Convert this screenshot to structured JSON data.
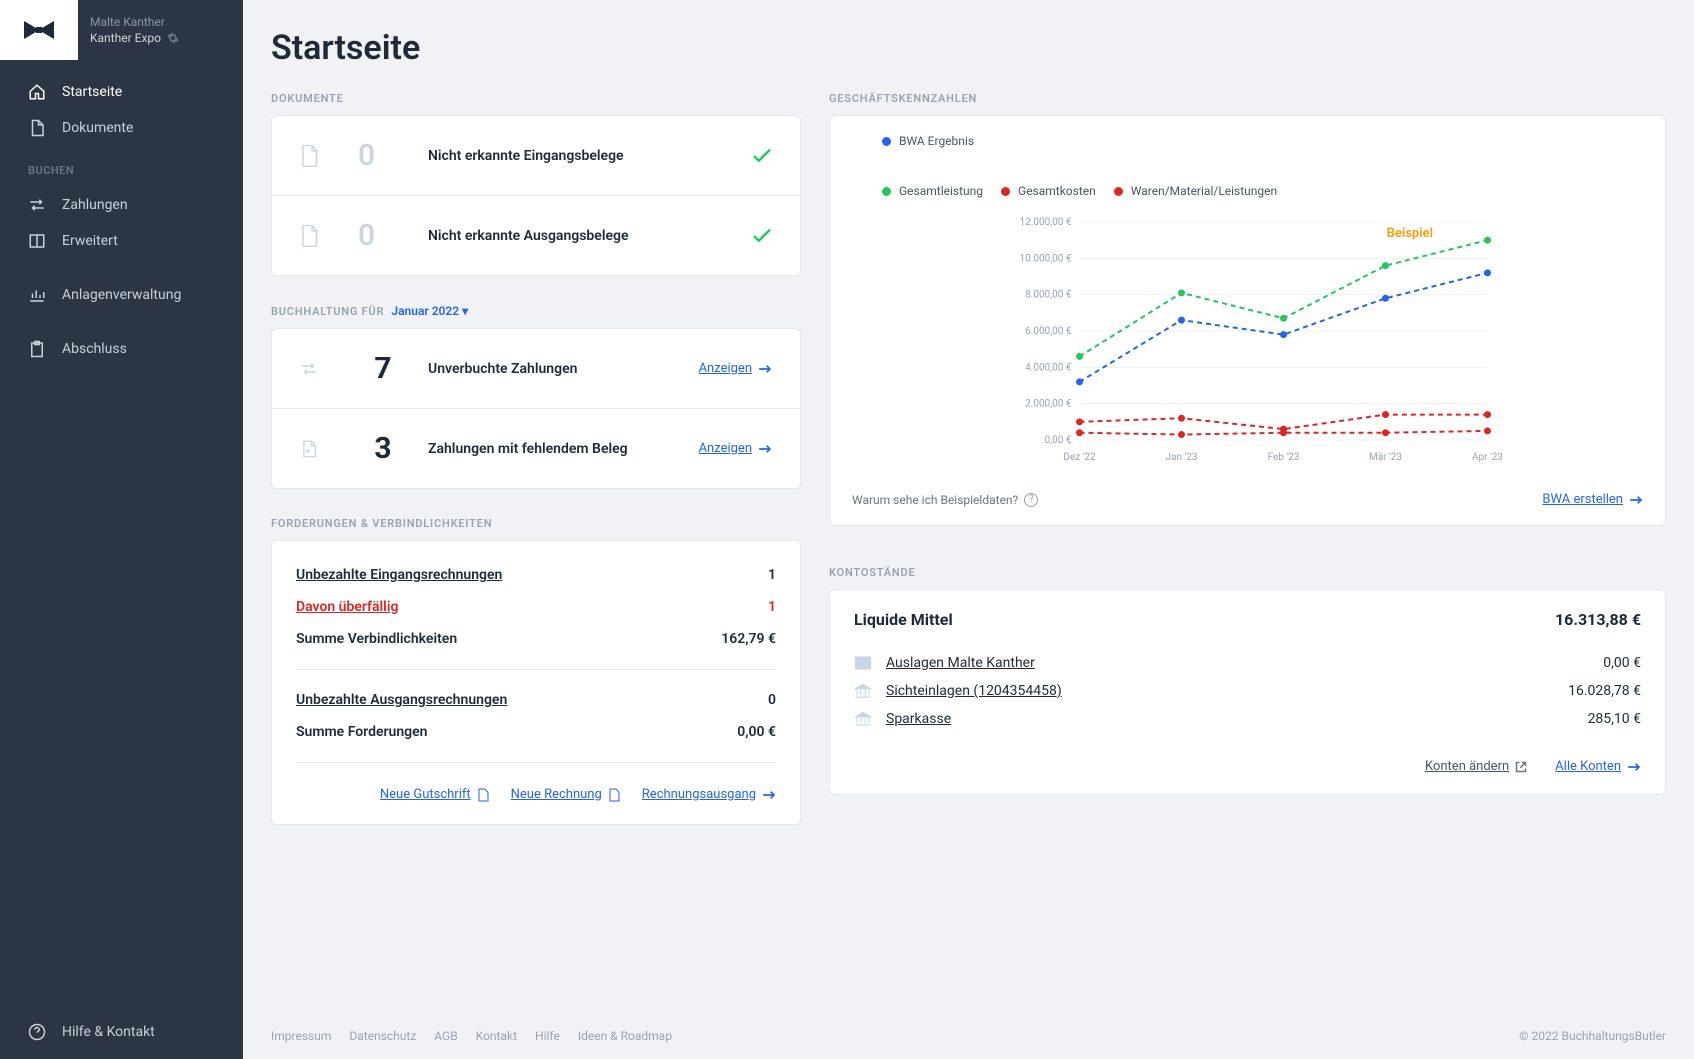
{
  "user": {
    "name": "Malte Kanther",
    "company": "Kanther Expo"
  },
  "sidebar": {
    "items": [
      {
        "label": "Startseite"
      },
      {
        "label": "Dokumente"
      },
      {
        "label": "Zahlungen"
      },
      {
        "label": "Erweitert"
      },
      {
        "label": "Anlagenverwaltung"
      },
      {
        "label": "Abschluss"
      }
    ],
    "section_buchen": "BUCHEN",
    "help": "Hilfe & Kontakt"
  },
  "page": {
    "title": "Startseite"
  },
  "documents": {
    "heading": "DOKUMENTE",
    "rows": [
      {
        "count": "0",
        "label": "Nicht erkannte Eingangsbelege"
      },
      {
        "count": "0",
        "label": "Nicht erkannte Ausgangsbelege"
      }
    ]
  },
  "bookkeeping": {
    "heading": "BUCHHALTUNG FÜR",
    "period": "Januar 2022",
    "rows": [
      {
        "count": "7",
        "label": "Unverbuchte Zahlungen",
        "action": "Anzeigen"
      },
      {
        "count": "3",
        "label": "Zahlungen mit fehlendem Beleg",
        "action": "Anzeigen"
      }
    ]
  },
  "receivables": {
    "heading": "FORDERUNGEN & VERBINDLICHKEITEN",
    "in_unpaid": {
      "label": "Unbezahlte Eingangsrechnungen",
      "value": "1"
    },
    "in_overdue": {
      "label": "Davon überfällig",
      "value": "1"
    },
    "in_sum": {
      "label": "Summe Verbindlichkeiten",
      "value": "162,79 €"
    },
    "out_unpaid": {
      "label": "Unbezahlte Ausgangsrechnungen",
      "value": "0"
    },
    "out_sum": {
      "label": "Summe Forderungen",
      "value": "0,00 €"
    },
    "actions": {
      "credit": "Neue Gutschrift",
      "invoice": "Neue Rechnung",
      "outgoing": "Rechnungsausgang"
    }
  },
  "kpi": {
    "heading": "GESCHÄFTSKENNZAHLEN",
    "legend": {
      "bwa": "BWA Ergebnis",
      "gesamtleistung": "Gesamtleistung",
      "gesamtkosten": "Gesamtkosten",
      "waren": "Waren/Material/Leistungen"
    },
    "watermark": "Beispiel",
    "hint": "Warum sehe ich Beispieldaten?",
    "action": "BWA erstellen"
  },
  "balances": {
    "heading": "KONTOSTÄNDE",
    "title": "Liquide Mittel",
    "total": "16.313,88 €",
    "rows": [
      {
        "name": "Auslagen Malte Kanther",
        "value": "0,00 €"
      },
      {
        "name": "Sichteinlagen (1204354458)",
        "value": "16.028,78 €"
      },
      {
        "name": "Sparkasse",
        "value": "285,10 €"
      }
    ],
    "actions": {
      "edit": "Konten ändern",
      "all": "Alle Konten"
    }
  },
  "footer": {
    "links": [
      "Impressum",
      "Datenschutz",
      "AGB",
      "Kontakt",
      "Hilfe",
      "Ideen & Roadmap"
    ],
    "copyright": "© 2022 BuchhaltungsButler"
  },
  "chart_data": {
    "type": "line",
    "title": "Geschäftskennzahlen (Beispiel)",
    "xlabel": "",
    "ylabel": "€",
    "ylim": [
      0,
      12000
    ],
    "categories": [
      "Dez '22",
      "Jan '23",
      "Feb '23",
      "Mär '23",
      "Apr '23"
    ],
    "y_ticks": [
      "0,00 €",
      "2.000,00 €",
      "4.000,00 €",
      "6.000,00 €",
      "8.000,00 €",
      "10.000,00 €",
      "12.000,00 €"
    ],
    "series": [
      {
        "name": "BWA Ergebnis",
        "color": "#2563eb",
        "values": [
          3200,
          6600,
          5800,
          7800,
          9200
        ]
      },
      {
        "name": "Gesamtleistung",
        "color": "#22c55e",
        "values": [
          4600,
          8100,
          6700,
          9600,
          11000
        ]
      },
      {
        "name": "Gesamtkosten",
        "color": "#dc2626",
        "values": [
          1000,
          1200,
          600,
          1400,
          1400
        ]
      },
      {
        "name": "Waren/Material/Leistungen",
        "color": "#dc2626",
        "values": [
          400,
          300,
          400,
          400,
          500
        ]
      }
    ]
  }
}
